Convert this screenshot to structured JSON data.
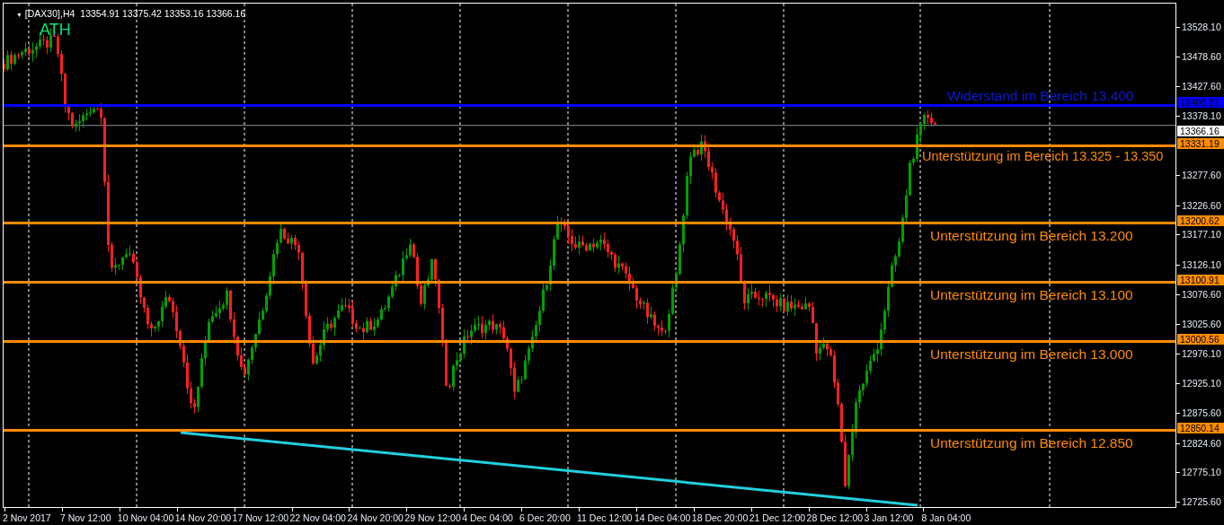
{
  "chart_header": {
    "menu_glyph": "▼",
    "symbol": "[DAX30],H4",
    "ohlc": "13354.91 13375.42 13353.16 13366.16"
  },
  "ath_label": "ATH",
  "levels": [
    {
      "kind": "resistance",
      "price_label": "13400.21",
      "text": "Widerstand im Bereich 13.400",
      "color": "#0000ff"
    },
    {
      "kind": "support",
      "price_label": "13331.19",
      "text": "Unterstützung im Bereich 13.325 - 13.350",
      "color": "#ff8c00"
    },
    {
      "kind": "support",
      "price_label": "13200.62",
      "text": "Unterstützung im Bereich 13.200",
      "color": "#ff8c00"
    },
    {
      "kind": "support",
      "price_label": "13100.91",
      "text": "Unterstützung im Bereich 13.100",
      "color": "#ff8c00"
    },
    {
      "kind": "support",
      "price_label": "13000.56",
      "text": "Unterstützung im Bereich 13.000",
      "color": "#ff8c00"
    },
    {
      "kind": "support",
      "price_label": "12850.14",
      "text": "Unterstützung im Bereich 12.850",
      "color": "#ff8c00"
    }
  ],
  "current_price": "13366.16",
  "price_ticks": [
    "13528.10",
    "13478.60",
    "13427.60",
    "13378.10",
    "13277.60",
    "13226.60",
    "13177.10",
    "13126.10",
    "13076.60",
    "13025.60",
    "12976.10",
    "12925.10",
    "12875.60",
    "12824.60",
    "12775.10",
    "12725.60"
  ],
  "time_labels": [
    "2 Nov 2017",
    "7 Nov 12:00",
    "10 Nov 04:00",
    "14 Nov 20:00",
    "17 Nov 12:00",
    "22 Nov 04:00",
    "24 Nov 20:00",
    "29 Nov 12:00",
    "4 Dec 04:00",
    "6 Dec 20:00",
    "11 Dec 12:00",
    "14 Dec 04:00",
    "18 Dec 20:00",
    "21 Dec 12:00",
    "28 Dec 12:00",
    "3 Jan 12:00",
    "8 Jan 04:00"
  ]
}
